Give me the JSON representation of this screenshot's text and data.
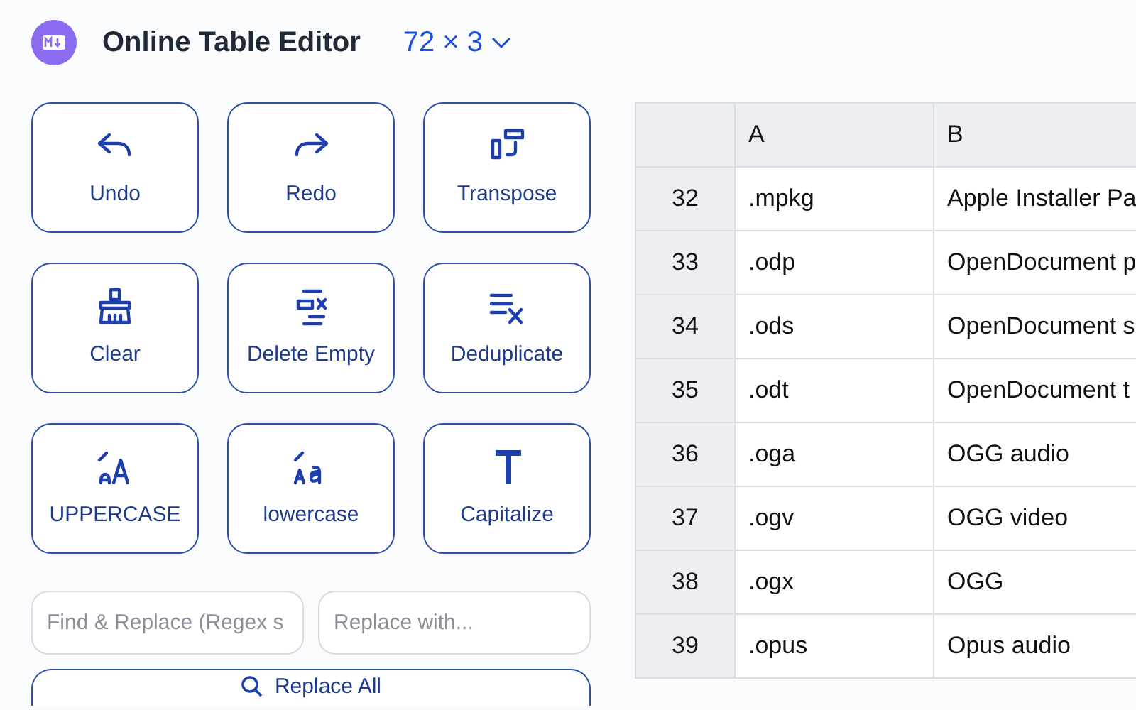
{
  "header": {
    "title": "Online Table Editor",
    "size": "72 × 3"
  },
  "actions": [
    {
      "kind": "undo",
      "label": "Undo"
    },
    {
      "kind": "redo",
      "label": "Redo"
    },
    {
      "kind": "transpose",
      "label": "Transpose"
    },
    {
      "kind": "clear",
      "label": "Clear"
    },
    {
      "kind": "delete-empty",
      "label": "Delete Empty"
    },
    {
      "kind": "deduplicate",
      "label": "Deduplicate"
    },
    {
      "kind": "uppercase",
      "label": "UPPERCASE"
    },
    {
      "kind": "lowercase",
      "label": "lowercase"
    },
    {
      "kind": "capitalize",
      "label": "Capitalize"
    }
  ],
  "find": {
    "placeholder": "Find & Replace (Regex s"
  },
  "replace": {
    "placeholder": "Replace with..."
  },
  "replace_all": {
    "label": "Replace All"
  },
  "table": {
    "columns": [
      "A",
      "B"
    ],
    "rows": [
      {
        "index": "32",
        "cells": [
          ".mpkg",
          "Apple Installer Pa"
        ]
      },
      {
        "index": "33",
        "cells": [
          ".odp",
          "OpenDocument p"
        ]
      },
      {
        "index": "34",
        "cells": [
          ".ods",
          "OpenDocument s"
        ]
      },
      {
        "index": "35",
        "cells": [
          ".odt",
          "OpenDocument t"
        ]
      },
      {
        "index": "36",
        "cells": [
          ".oga",
          "OGG audio"
        ]
      },
      {
        "index": "37",
        "cells": [
          ".ogv",
          "OGG video"
        ]
      },
      {
        "index": "38",
        "cells": [
          ".ogx",
          "OGG"
        ]
      },
      {
        "index": "39",
        "cells": [
          ".opus",
          "Opus audio"
        ]
      }
    ]
  }
}
